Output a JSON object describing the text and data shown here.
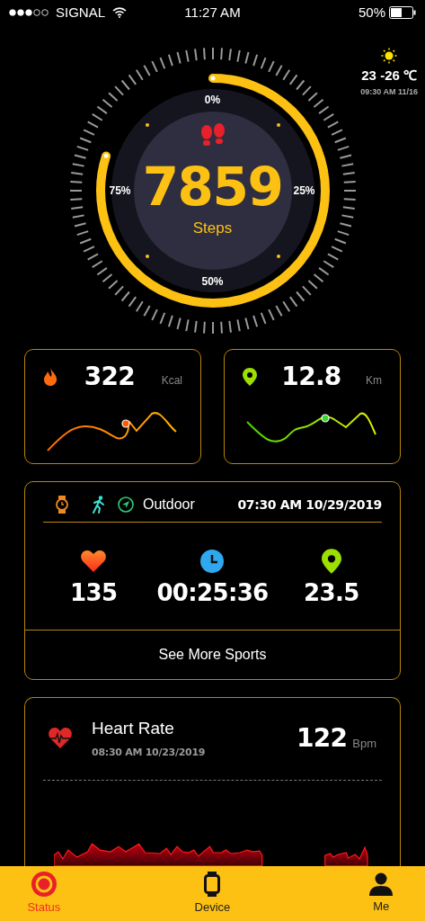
{
  "status_bar": {
    "carrier": "SIGNAL",
    "time": "11:27 AM",
    "battery": "50%"
  },
  "weather": {
    "temperature": "23 -26 ℃",
    "updated": "09:30 AM 11/16"
  },
  "steps": {
    "value": "7859",
    "unit": "Steps",
    "level": 0.8,
    "scale": [
      "0%",
      "25%",
      "50%",
      "75%"
    ]
  },
  "metrics": [
    {
      "kind": "calories",
      "value": "322",
      "unit": "Kcal"
    },
    {
      "kind": "distance",
      "value": "12.8",
      "unit": "Km"
    }
  ],
  "sport": {
    "mode": "Outdoor",
    "datetime": "07:30 AM 10/29/2019",
    "stats": [
      {
        "kind": "heart",
        "value": "135"
      },
      {
        "kind": "duration",
        "value": "00:25:36"
      },
      {
        "kind": "distance",
        "value": "23.5"
      }
    ],
    "more": "See More Sports"
  },
  "heart_rate": {
    "title": "Heart Rate",
    "datetime": "08:30 AM 10/23/2019",
    "value": "122",
    "unit": "Bpm"
  },
  "tabs": [
    {
      "kind": "status",
      "label": "Status",
      "selected": true
    },
    {
      "kind": "device",
      "label": "Device",
      "selected": false
    },
    {
      "kind": "me",
      "label": "Me",
      "selected": false
    }
  ]
}
